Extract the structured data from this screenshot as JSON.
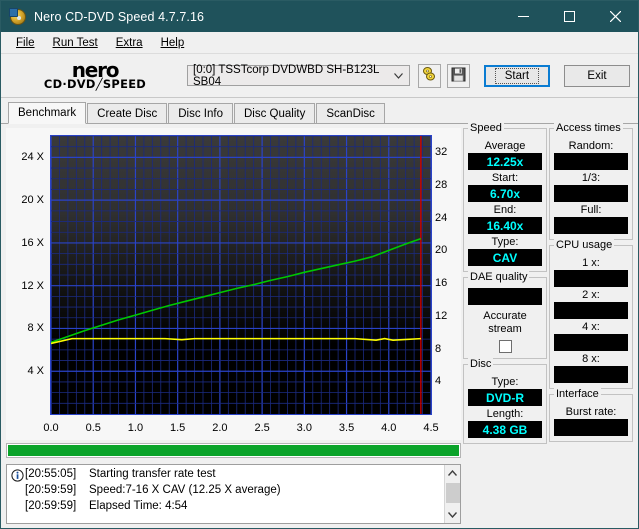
{
  "window": {
    "title": "Nero CD-DVD Speed 4.7.7.16",
    "icon": "nero-disc-icon",
    "controls": [
      {
        "name": "minimize",
        "glyph": "minimize-icon"
      },
      {
        "name": "maximize",
        "glyph": "maximize-icon"
      },
      {
        "name": "close",
        "glyph": "close-icon"
      }
    ]
  },
  "menu": {
    "items": [
      "File",
      "Run Test",
      "Extra",
      "Help"
    ]
  },
  "toolbar": {
    "logo_main": "nero",
    "logo_sub_left": "CD·DVD",
    "logo_sub_right": "SPEED",
    "drive": "[0:0]   TSSTcorp DVDWBD SH-B123L SB04",
    "drive_arrow": "chevron-down-icon",
    "disc_info_icon": "disc-tool-icon",
    "save_icon": "save-floppy-icon",
    "start_label": "Start",
    "exit_label": "Exit"
  },
  "tabs": [
    {
      "label": "Benchmark",
      "active": true
    },
    {
      "label": "Create Disc",
      "active": false
    },
    {
      "label": "Disc Info",
      "active": false
    },
    {
      "label": "Disc Quality",
      "active": false
    },
    {
      "label": "ScanDisc",
      "active": false
    }
  ],
  "chart_data": {
    "type": "line",
    "title": "",
    "xlabel": "",
    "ylabel": "",
    "xlim": [
      0.0,
      4.5
    ],
    "ylim": [
      0,
      26
    ],
    "y2lim": [
      0,
      34
    ],
    "grid": true,
    "legend": "none",
    "x_ticks": [
      "0.0",
      "0.5",
      "1.0",
      "1.5",
      "2.0",
      "2.5",
      "3.0",
      "3.5",
      "4.0",
      "4.5"
    ],
    "y_ticks_left": [
      "4 X",
      "8 X",
      "12 X",
      "16 X",
      "20 X",
      "24 X"
    ],
    "y_tick_values_left": [
      4,
      8,
      12,
      16,
      20,
      24
    ],
    "y_ticks_right": [
      "4",
      "8",
      "12",
      "16",
      "20",
      "24",
      "28",
      "32"
    ],
    "y_tick_values_right": [
      4,
      8,
      12,
      16,
      20,
      24,
      28,
      32
    ],
    "series": [
      {
        "name": "transfer-rate",
        "color": "#00c800",
        "x": [
          0.0,
          0.2,
          0.4,
          0.6,
          0.8,
          1.0,
          1.2,
          1.4,
          1.6,
          1.8,
          2.0,
          2.2,
          2.4,
          2.6,
          2.8,
          3.0,
          3.2,
          3.4,
          3.6,
          3.8,
          4.0,
          4.2,
          4.38
        ],
        "values": [
          6.7,
          7.25,
          7.8,
          8.3,
          8.8,
          9.25,
          9.7,
          10.15,
          10.55,
          10.95,
          11.35,
          11.75,
          12.1,
          12.5,
          12.85,
          13.25,
          13.6,
          13.95,
          14.3,
          14.7,
          15.3,
          15.9,
          16.4
        ]
      },
      {
        "name": "cpu-usage-trace",
        "color": "#ffff00",
        "x": [
          0.0,
          0.25,
          0.45,
          1.35,
          1.55,
          1.7,
          1.8,
          2.0,
          3.6,
          3.85,
          3.95,
          4.05,
          4.38
        ],
        "values": [
          6.6,
          7.05,
          7.05,
          7.05,
          6.95,
          7.05,
          7.05,
          7.05,
          7.05,
          6.9,
          7.05,
          6.9,
          7.05
        ]
      }
    ],
    "markers": [
      {
        "name": "disc-end-line",
        "x": 4.38,
        "color": "#cc0000"
      }
    ]
  },
  "progress": {
    "percent": 100,
    "color": "#0aa329"
  },
  "log": {
    "rows": [
      {
        "icon": "info-icon",
        "time": "[20:55:05]",
        "message": "Starting transfer rate test"
      },
      {
        "icon": "",
        "time": "[20:59:59]",
        "message": "Speed:7-16 X CAV (12.25 X average)"
      },
      {
        "icon": "",
        "time": "[20:59:59]",
        "message": "Elapsed Time:  4:54"
      }
    ],
    "scroll_up": "chevron-up-icon",
    "scroll_down": "chevron-down-icon"
  },
  "panels": {
    "speed": {
      "legend": "Speed",
      "fields": [
        {
          "label": "Average",
          "value": "12.25x"
        },
        {
          "label": "Start:",
          "value": "6.70x"
        },
        {
          "label": "End:",
          "value": "16.40x"
        },
        {
          "label": "Type:",
          "value": "CAV"
        }
      ]
    },
    "dae_quality": {
      "legend": "DAE quality",
      "value": "",
      "checkbox_label_line1": "Accurate",
      "checkbox_label_line2": "stream",
      "checked": false
    },
    "disc": {
      "legend": "Disc",
      "fields": [
        {
          "label": "Type:",
          "value": "DVD-R"
        },
        {
          "label": "Length:",
          "value": "4.38 GB"
        }
      ]
    },
    "access_times": {
      "legend": "Access times",
      "fields": [
        {
          "label": "Random:",
          "value": ""
        },
        {
          "label": "1/3:",
          "value": ""
        },
        {
          "label": "Full:",
          "value": ""
        }
      ]
    },
    "cpu_usage": {
      "legend": "CPU usage",
      "fields": [
        {
          "label": "1 x:",
          "value": ""
        },
        {
          "label": "2 x:",
          "value": ""
        },
        {
          "label": "4 x:",
          "value": ""
        },
        {
          "label": "8 x:",
          "value": ""
        }
      ]
    },
    "interface": {
      "legend": "Interface",
      "fields": [
        {
          "label": "Burst rate:",
          "value": ""
        }
      ]
    }
  },
  "colors": {
    "titlebar": "#1f525b",
    "value_text": "#00ffff",
    "curve_green": "#00c800",
    "curve_yellow": "#ffff00",
    "grid_blue": "#2a43c8",
    "progress_green": "#0aa329"
  }
}
